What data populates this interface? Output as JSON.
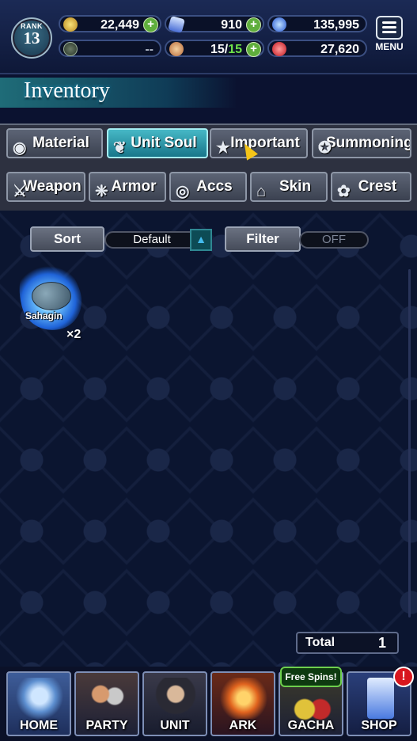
{
  "header": {
    "rank_label": "RANK",
    "rank_value": "13",
    "currencies": [
      {
        "icon": "gil-coin-icon",
        "value": "22,449",
        "has_plus": true
      },
      {
        "icon": "lapis-crystal-icon",
        "value": "910",
        "has_plus": true
      },
      {
        "icon": "blue-orb-icon",
        "value": "135,995",
        "has_plus": false
      },
      {
        "icon": "sword-emblem-icon",
        "value": "--",
        "has_plus": false
      },
      {
        "icon": "stamina-ticket-icon",
        "value_main": "15/",
        "value_max": "15",
        "has_plus": true
      },
      {
        "icon": "red-orb-icon",
        "value": "27,620",
        "has_plus": false
      }
    ],
    "menu_label": "MENU"
  },
  "page_title": "Inventory",
  "categories_row1": [
    {
      "label": "Material",
      "icon": "bag-icon",
      "selected": false
    },
    {
      "label": "Unit Soul",
      "icon": "soul-flame-icon",
      "selected": true
    },
    {
      "label": "Important",
      "icon": "star-icon",
      "selected": false
    },
    {
      "label": "Summoning",
      "icon": "summon-icon",
      "selected": false
    }
  ],
  "categories_row2": [
    {
      "label": "Weapon",
      "icon": "sword-icon"
    },
    {
      "label": "Armor",
      "icon": "armor-icon"
    },
    {
      "label": "Accs",
      "icon": "necklace-icon"
    },
    {
      "label": "Skin",
      "icon": "hanger-icon"
    },
    {
      "label": "Crest",
      "icon": "crest-icon"
    }
  ],
  "sort": {
    "label": "Sort",
    "value": "Default"
  },
  "filter": {
    "label": "Filter",
    "value": "OFF"
  },
  "items": [
    {
      "name": "Sahagin",
      "quantity": "×2"
    }
  ],
  "total": {
    "label": "Total",
    "value": "1"
  },
  "nav": [
    {
      "label": "HOME"
    },
    {
      "label": "PARTY"
    },
    {
      "label": "UNIT"
    },
    {
      "label": "ARK"
    },
    {
      "label": "GACHA",
      "badge": "Free Spins!"
    },
    {
      "label": "SHOP",
      "alert": "!"
    }
  ],
  "colors": {
    "selected_tab": "#18768a",
    "plus_green": "#5fae3c",
    "stamina_green": "#6ee14a",
    "alert_red": "#d8161e"
  }
}
